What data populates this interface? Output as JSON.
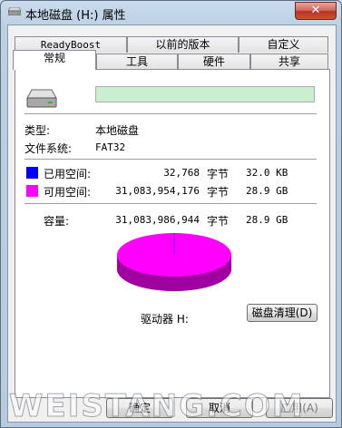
{
  "window": {
    "title": "本地磁盘 (H:) 属性",
    "close_label": "✕"
  },
  "tabs_back": [
    "ReadyBoost",
    "以前的版本",
    "自定义"
  ],
  "tabs_front": [
    "常规",
    "工具",
    "硬件",
    "共享"
  ],
  "general": {
    "name_value": "",
    "type_label": "类型:",
    "type_value": "本地磁盘",
    "fs_label": "文件系统:",
    "fs_value": "FAT32",
    "used": {
      "label": "已用空间:",
      "bytes": "32,768",
      "unit": "字节",
      "size": "32.0 KB",
      "color": "#0000ff"
    },
    "free": {
      "label": "可用空间:",
      "bytes": "31,083,954,176",
      "unit": "字节",
      "size": "28.9 GB",
      "color": "#ff00ff"
    },
    "capacity": {
      "label": "容量:",
      "bytes": "31,083,986,944",
      "unit": "字节",
      "size": "28.9 GB"
    },
    "drive_label": "驱动器 H:",
    "cleanup_label": "磁盘清理(D)"
  },
  "buttons": {
    "ok": "确定",
    "cancel": "取消",
    "apply": "应用(A)"
  },
  "watermark": "WEISTANG.COM",
  "colors": {
    "used": "#0000ff",
    "free": "#ff00ff",
    "free_dark": "#a000a0",
    "title_bg": "#c9dbec"
  }
}
